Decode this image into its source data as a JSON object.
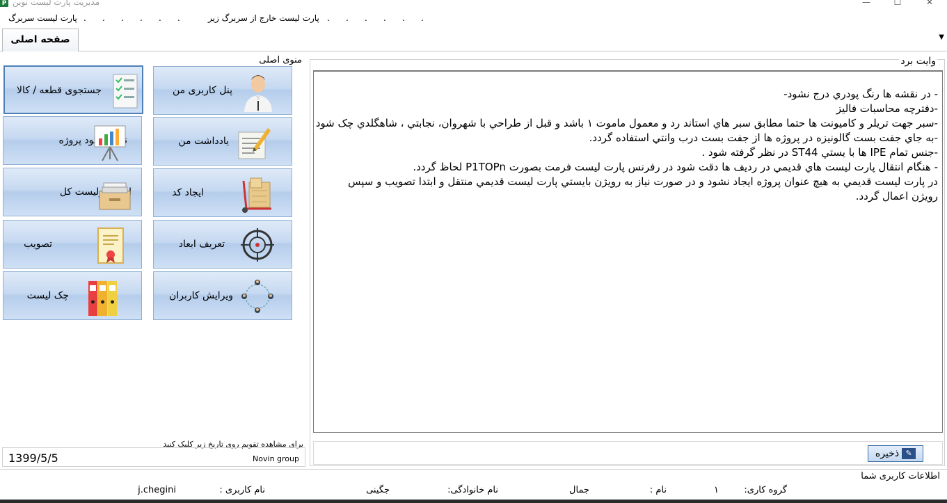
{
  "window": {
    "title": "مدیریت پارت لیست نوین",
    "app_icon": "P",
    "minimize_glyph": "—",
    "maximize_glyph": "☐",
    "close_glyph": "✕"
  },
  "menubar": {
    "items": [
      {
        "label": "پارت لیست سربرگ"
      },
      {
        "label": "."
      },
      {
        "label": "."
      },
      {
        "label": "."
      },
      {
        "label": "."
      },
      {
        "label": "."
      },
      {
        "label": "."
      },
      {
        "label": "پارت لیست خارج از سربرگ زیر"
      },
      {
        "label": "."
      },
      {
        "label": "."
      },
      {
        "label": "."
      },
      {
        "label": "."
      },
      {
        "label": "."
      },
      {
        "label": "."
      }
    ]
  },
  "tabs": {
    "main_label": "صفحه اصلی",
    "dropdown_glyph": "▼"
  },
  "main_menu": {
    "caption": "منوی اصلی",
    "tiles": [
      {
        "label": "پنل کاربری من",
        "icon": "user-avatar-icon"
      },
      {
        "label": "جستجوی قطعه / کالا",
        "icon": "checklist-icon"
      },
      {
        "label": "یادداشت من",
        "icon": "note-pencil-icon"
      },
      {
        "label": "نکات بهبود پروژه",
        "icon": "chart-board-icon"
      },
      {
        "label": "ایجاد کد",
        "icon": "hand-truck-icon"
      },
      {
        "label": "ایجاد پارلیست کل",
        "icon": "file-drawer-icon"
      },
      {
        "label": "تعریف ابعاد",
        "icon": "crosshair-icon"
      },
      {
        "label": "تصویب",
        "icon": "certificate-icon"
      },
      {
        "label": "ویرایش کاربران",
        "icon": "users-network-icon"
      },
      {
        "label": "چک لیست",
        "icon": "binders-icon"
      }
    ]
  },
  "calendar": {
    "hint": "برای مشاهده تقویم روی تاریخ زیر کلیک کنید",
    "date": "1399/5/5",
    "brand": "Novin group"
  },
  "whiteboard": {
    "caption": "وایت برد",
    "lines": [
      "- در نقشه ها  رنگ پودري درج نشود-",
      "-دفترچه محاسبات فالیز",
      "-سبر جهت تريلر و كاميونت ها حتما مطابق سبر هاي استاند رد و معمول ماموت ۱ باشد  و قبل از طراحي با شهروان، نجابتي ، شاهگلدي چک شود",
      "-به جاي جفت بست گالونيزه  در پروژه  ها از جفت بست درب وانتي استفاده گردد.",
      "-جنس  تمام IPE ها با يستي ST44 در نظر گرفته شود .",
      "- هنگام انتقال پارت ليست هاي قديمي در رديف ها دقت شود  در رفرنس پارت ليست فرمت بصورت  P1TOPn لحاظ گردد.",
      "در پارت ليست قديمي به هيچ عنوان پروژه ايجاد نشود  و در صورت نياز به رويژن بايستي پارت ليست قديمي منتقل و ابتدا تصويب و  سپس",
      "رويژن اعمال گردد."
    ],
    "save_label": "ذخیره",
    "save_icon": "pen-icon"
  },
  "user_info": {
    "caption": "اطلاعات کاربری شما",
    "group_label": "گروه کاری:",
    "group_value": "۱",
    "name_label": "نام :",
    "name_value": "جمال",
    "family_label": "نام خانوادگی:",
    "family_value": "جگینی",
    "username_label": "نام کاربری :",
    "username_value": "j.chegini"
  }
}
